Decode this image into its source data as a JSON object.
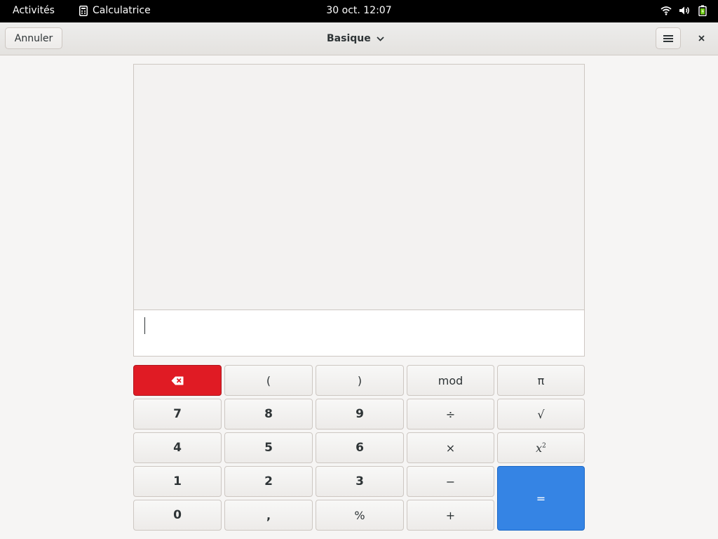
{
  "topbar": {
    "activities": "Activités",
    "app_name": "Calculatrice",
    "app_icon": "calculator-icon",
    "clock": "30 oct.  12:07",
    "tray_icons": [
      "wifi-icon",
      "volume-icon",
      "battery-icon"
    ]
  },
  "header": {
    "cancel_label": "Annuler",
    "mode_label": "Basique",
    "menu_icon": "hamburger-menu-icon",
    "close_icon": "close-icon"
  },
  "display": {
    "entry_value": ""
  },
  "keypad": {
    "row1": [
      "backspace",
      "(",
      ")",
      "mod",
      "π"
    ],
    "row2": [
      "7",
      "8",
      "9",
      "÷",
      "√"
    ],
    "row3": [
      "4",
      "5",
      "6",
      "×",
      "x²"
    ],
    "row4": [
      "1",
      "2",
      "3",
      "−",
      "="
    ],
    "row5": [
      "0",
      ",",
      "%",
      "+"
    ],
    "labels": {
      "lparen": "(",
      "rparen": ")",
      "mod": "mod",
      "pi": "π",
      "n7": "7",
      "n8": "8",
      "n9": "9",
      "divide": "÷",
      "sqrt": "√",
      "n4": "4",
      "n5": "5",
      "n6": "6",
      "multiply": "×",
      "square_base": "x",
      "square_exp": "2",
      "n1": "1",
      "n2": "2",
      "n3": "3",
      "minus": "−",
      "equals": "=",
      "n0": "0",
      "comma": ",",
      "percent": "%",
      "plus": "+"
    }
  },
  "colors": {
    "delete_key": "#e01b24",
    "equals_key": "#3584e4"
  }
}
